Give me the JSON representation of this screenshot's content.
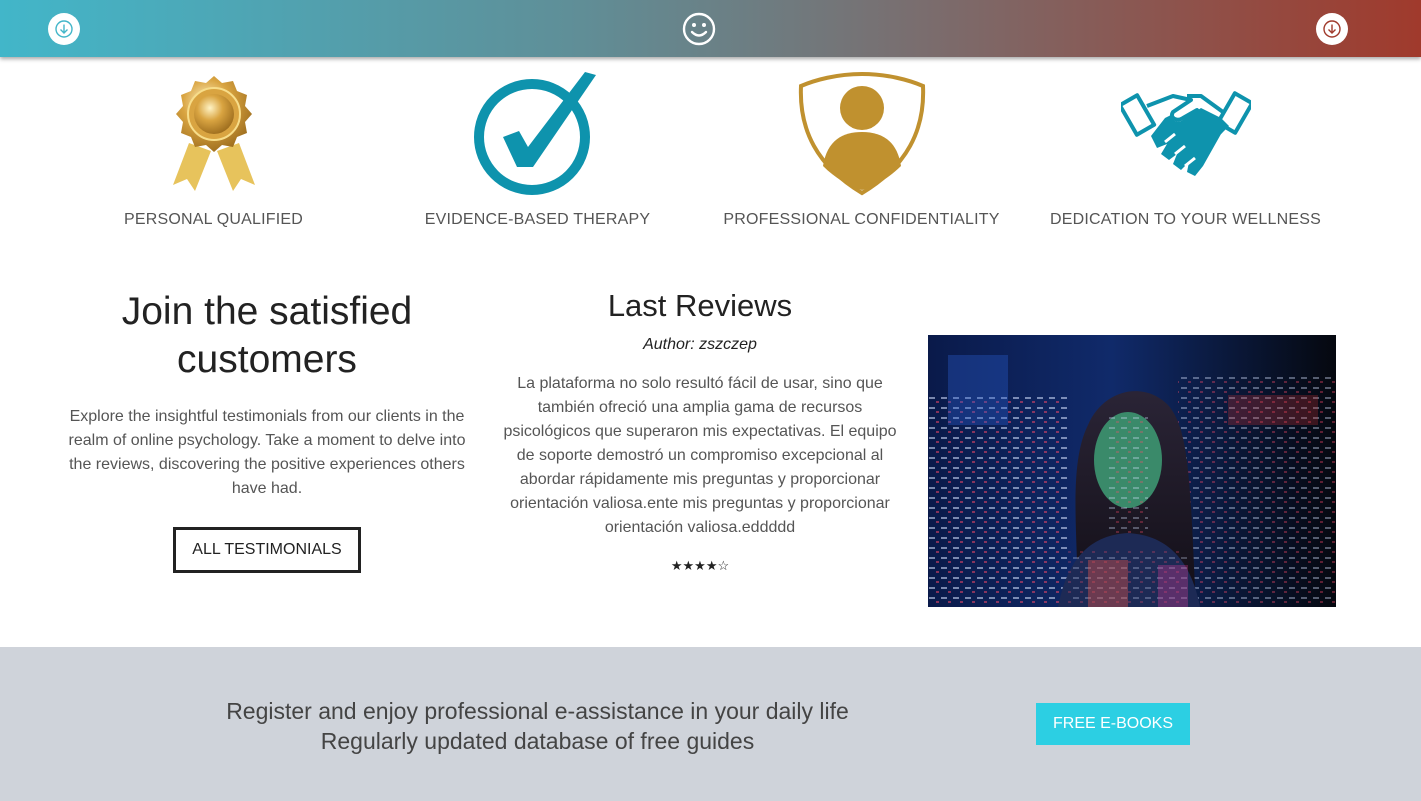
{
  "header": {
    "left_icon": "arrow-down-icon",
    "center_icon": "smiley-icon",
    "right_icon": "arrow-down-icon",
    "colors": {
      "left": "#42b6c9",
      "right": "#a03a2c"
    }
  },
  "features": [
    {
      "icon": "gold-medal-icon",
      "label": "PERSONAL QUALIFIED"
    },
    {
      "icon": "checkmark-circle-icon",
      "label": "EVIDENCE-BASED THERAPY"
    },
    {
      "icon": "shield-person-icon",
      "label": "PROFESSIONAL CONFIDENTIALITY"
    },
    {
      "icon": "handshake-icon",
      "label": "DEDICATION TO YOUR WELLNESS"
    }
  ],
  "join": {
    "title": "Join the satisfied customers",
    "description": "Explore the insightful testimonials from our clients in the realm of online psychology. Take a moment to delve into the reviews, discovering the positive experiences others have had.",
    "button_label": "ALL TESTIMONIALS"
  },
  "reviews": {
    "title": "Last Reviews",
    "author": "Author: zszczep",
    "text": "La plataforma no solo resultó fácil de usar, sino que también ofreció una amplia gama de recursos psicológicos que superaron mis expectativas. El equipo de soporte demostró un compromiso excepcional al abordar rápidamente mis preguntas y proporcionar orientación valiosa.ente mis preguntas y proporcionar orientación valiosa.eddddd",
    "stars": "★★★★☆",
    "rating": 4
  },
  "banner": {
    "line1": "Register and enjoy professional e-assistance in your daily life",
    "line2": "Regularly updated database of free guides",
    "button_label": "FREE E-BOOKS",
    "button_color": "#2ccfe3"
  }
}
